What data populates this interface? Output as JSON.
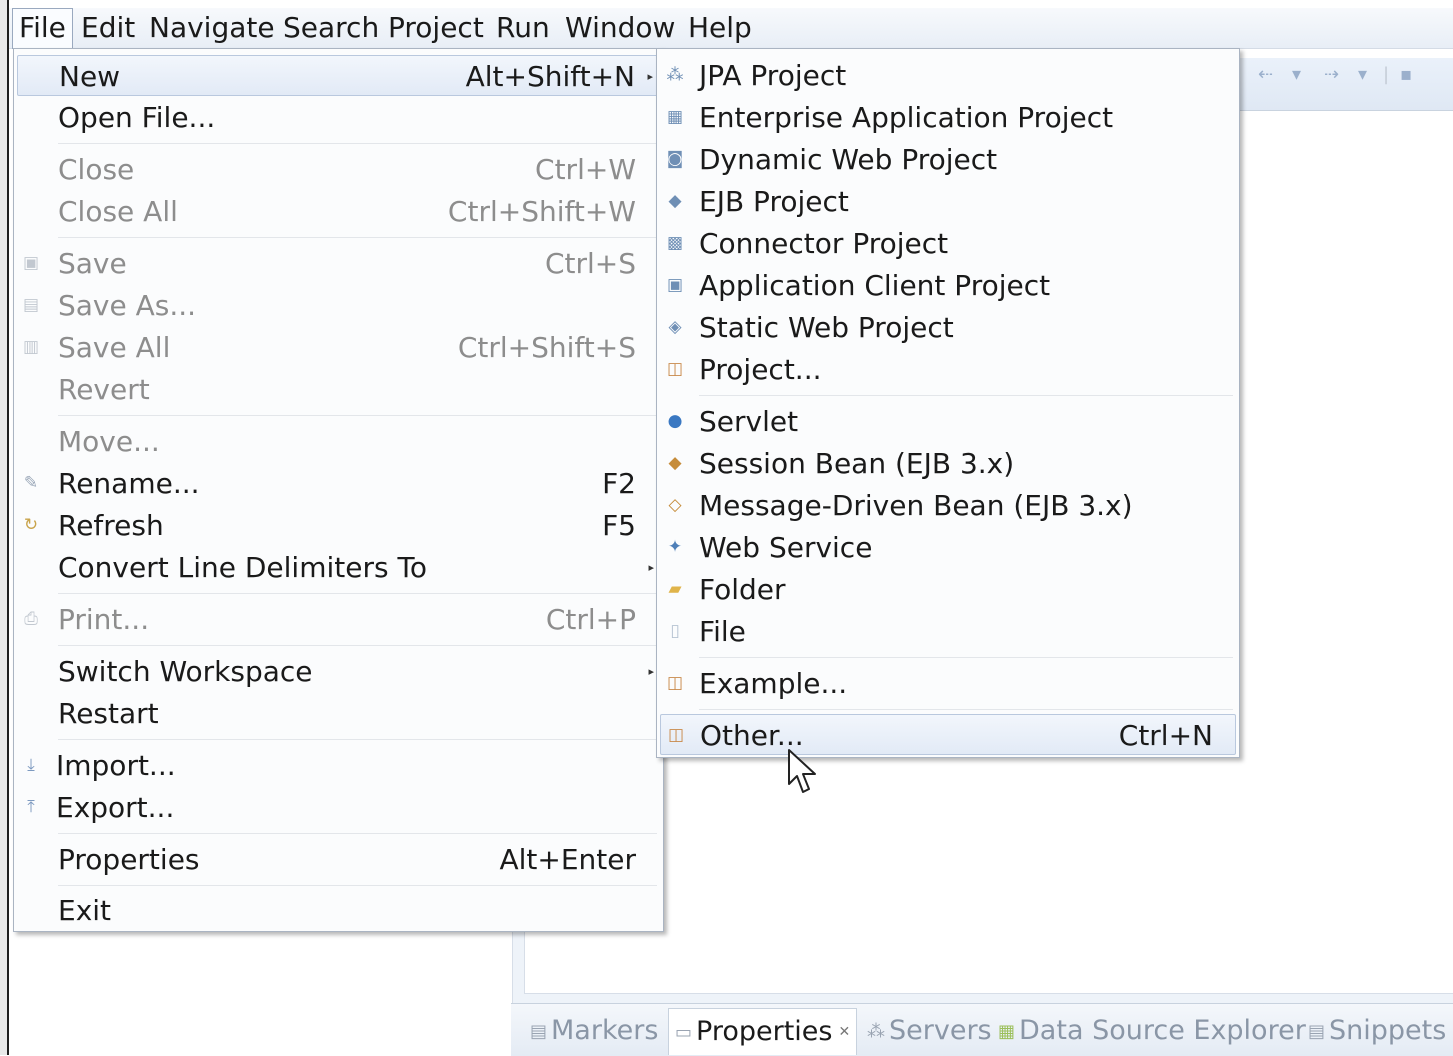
{
  "menubar": {
    "items": [
      "File",
      "Edit",
      "Navigate",
      "Search",
      "Project",
      "Run",
      "Window",
      "Help"
    ]
  },
  "file_menu": {
    "items": [
      {
        "label": "New",
        "shortcut": "Alt+Shift+N",
        "icon": "none",
        "enabled": true,
        "highlighted": true,
        "submenu": true
      },
      {
        "label": "Open File...",
        "shortcut": "",
        "icon": "none",
        "enabled": true
      },
      {
        "label": "Close",
        "shortcut": "Ctrl+W",
        "icon": "none",
        "enabled": false
      },
      {
        "label": "Close All",
        "shortcut": "Ctrl+Shift+W",
        "icon": "none",
        "enabled": false
      },
      {
        "label": "Save",
        "shortcut": "Ctrl+S",
        "icon": "save-icon",
        "enabled": false
      },
      {
        "label": "Save As...",
        "shortcut": "",
        "icon": "save-as-icon",
        "enabled": false
      },
      {
        "label": "Save All",
        "shortcut": "Ctrl+Shift+S",
        "icon": "save-all-icon",
        "enabled": false
      },
      {
        "label": "Revert",
        "shortcut": "",
        "icon": "none",
        "enabled": false
      },
      {
        "label": "Move...",
        "shortcut": "",
        "icon": "none",
        "enabled": false
      },
      {
        "label": "Rename...",
        "shortcut": "F2",
        "icon": "rename-icon",
        "enabled": true
      },
      {
        "label": "Refresh",
        "shortcut": "F5",
        "icon": "refresh-icon",
        "enabled": true
      },
      {
        "label": "Convert Line Delimiters To",
        "shortcut": "",
        "icon": "none",
        "enabled": true,
        "submenu": true
      },
      {
        "label": "Print...",
        "shortcut": "Ctrl+P",
        "icon": "print-icon",
        "enabled": false
      },
      {
        "label": "Switch Workspace",
        "shortcut": "",
        "icon": "none",
        "enabled": true,
        "submenu": true
      },
      {
        "label": "Restart",
        "shortcut": "",
        "icon": "none",
        "enabled": true
      },
      {
        "label": "Import...",
        "shortcut": "",
        "icon": "import-icon",
        "enabled": true
      },
      {
        "label": "Export...",
        "shortcut": "",
        "icon": "export-icon",
        "enabled": true
      },
      {
        "label": "Properties",
        "shortcut": "Alt+Enter",
        "icon": "none",
        "enabled": true
      },
      {
        "label": "Exit",
        "shortcut": "",
        "icon": "none",
        "enabled": true
      }
    ]
  },
  "new_submenu": {
    "items": [
      {
        "label": "JPA Project",
        "shortcut": "",
        "icon": "jpa-project-icon"
      },
      {
        "label": "Enterprise Application Project",
        "shortcut": "",
        "icon": "enterprise-application-project-icon"
      },
      {
        "label": "Dynamic Web Project",
        "shortcut": "",
        "icon": "dynamic-web-project-icon"
      },
      {
        "label": "EJB Project",
        "shortcut": "",
        "icon": "ejb-project-icon"
      },
      {
        "label": "Connector Project",
        "shortcut": "",
        "icon": "connector-project-icon"
      },
      {
        "label": "Application Client Project",
        "shortcut": "",
        "icon": "application-client-project-icon"
      },
      {
        "label": "Static Web Project",
        "shortcut": "",
        "icon": "static-web-project-icon"
      },
      {
        "label": "Project...",
        "shortcut": "",
        "icon": "project-icon"
      },
      {
        "label": "Servlet",
        "shortcut": "",
        "icon": "servlet-icon"
      },
      {
        "label": "Session Bean (EJB 3.x)",
        "shortcut": "",
        "icon": "session-bean-icon"
      },
      {
        "label": "Message-Driven Bean (EJB 3.x)",
        "shortcut": "",
        "icon": "message-driven-bean-icon"
      },
      {
        "label": "Web Service",
        "shortcut": "",
        "icon": "web-service-icon"
      },
      {
        "label": "Folder",
        "shortcut": "",
        "icon": "folder-icon"
      },
      {
        "label": "File",
        "shortcut": "",
        "icon": "file-icon"
      },
      {
        "label": "Example...",
        "shortcut": "",
        "icon": "example-icon"
      },
      {
        "label": "Other...",
        "shortcut": "Ctrl+N",
        "icon": "other-wizard-icon",
        "highlighted": true
      }
    ]
  },
  "bottom_views": {
    "tabs": [
      {
        "label": "Markers",
        "icon": "markers-icon"
      },
      {
        "label": "Properties",
        "icon": "properties-icon",
        "active": true
      },
      {
        "label": "Servers",
        "icon": "servers-icon"
      },
      {
        "label": "Data Source Explorer",
        "icon": "data-source-explorer-icon"
      },
      {
        "label": "Snippets",
        "icon": "snippets-icon"
      }
    ]
  },
  "colors": {
    "menu_background": "#fbfcfd",
    "highlight": "#e2eaf6",
    "disabled_text": "#8d8d8d",
    "menubar": "#e8eef6"
  }
}
